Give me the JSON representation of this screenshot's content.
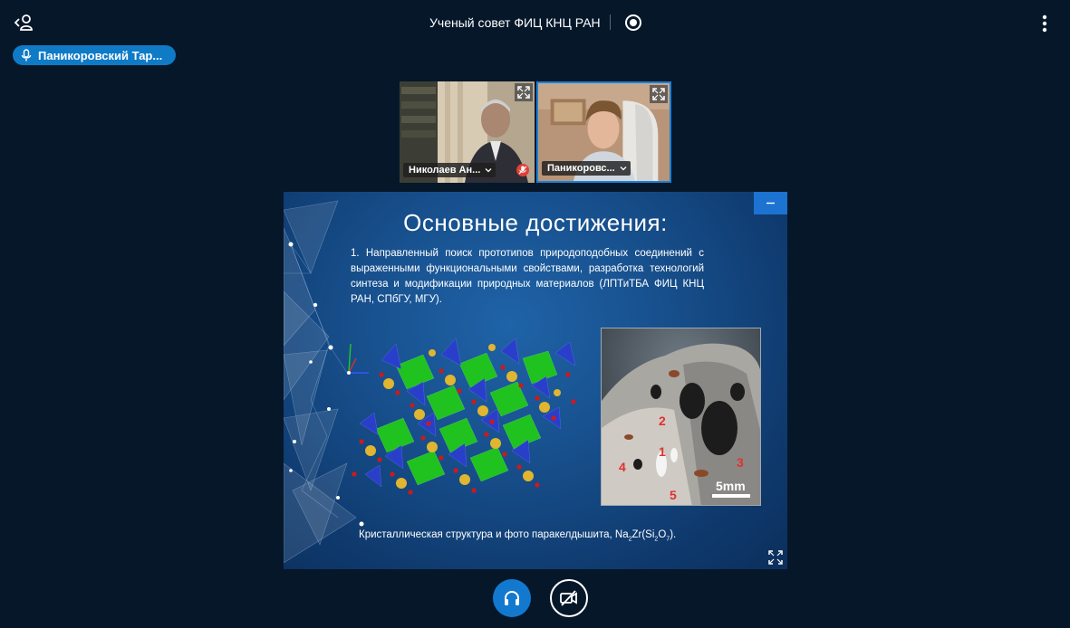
{
  "meeting": {
    "title": "Ученый совет ФИЦ КНЦ РАН"
  },
  "talking_indicator": {
    "name": "Паникоровский Тар..."
  },
  "webcams": [
    {
      "name": "Николаев Ан...",
      "status_icon": "locked-mic-icon",
      "status_color": "#e0403a"
    },
    {
      "name": "Паникоровс..."
    }
  ],
  "slide": {
    "title": "Основные достижения:",
    "paragraph": "1. Направленный поиск прототипов природоподобных соединений с выраженными функциональными свойствами, разработка технологий синтеза и модификации природных материалов (ЛПТиТБА ФИЦ КНЦ РАН, СПбГУ, МГУ).",
    "photo_marks": [
      "1",
      "2",
      "3",
      "4",
      "5"
    ],
    "scale_label": "5mm",
    "caption_prefix": "Кристаллическая структура и фото паракелдышита, Na",
    "caption_sub1": "2",
    "caption_mid": "Zr(Si",
    "caption_sub2": "2",
    "caption_mid2": "O",
    "caption_sub3": "7",
    "caption_suffix": ")."
  },
  "colors": {
    "background": "#06172a",
    "accent": "#1279cf",
    "polyhedron_green": "#1fc21f",
    "polyhedron_blue": "#2a3fc9",
    "atom_gold": "#e0b530",
    "atom_red": "#cc1a1a"
  }
}
